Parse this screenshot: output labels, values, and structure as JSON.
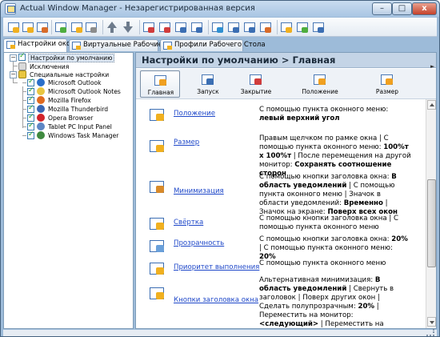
{
  "window": {
    "title": "Actual Window Manager - Незарегистрированная версия",
    "controls": {
      "minimize": "–",
      "maximize": "□",
      "close": "x"
    }
  },
  "toolbar": {
    "buttons": [
      "new-window-icon",
      "settings-icon",
      "refresh-icon",
      "add-rule-icon",
      "copy-icon",
      "paste-icon",
      "move-up-icon",
      "move-down-icon",
      "sort-az-icon",
      "sort-za-icon",
      "minimize-all-icon",
      "restore-all-icon",
      "swap-icon",
      "undo-icon",
      "redo-icon",
      "options-icon",
      "help-icon",
      "email-icon",
      "support-icon"
    ]
  },
  "tabs": [
    {
      "label": "Настройки окон",
      "active": true
    },
    {
      "label": "Виртуальные Рабочие Столы",
      "active": false
    },
    {
      "label": "Профили Рабочего Стола",
      "active": false
    }
  ],
  "tree": {
    "root": "Настройки по умолчанию",
    "exclusions": "Исключения",
    "specific": "Специальные настройки",
    "items": [
      {
        "label": "Microsoft Outlook",
        "icon": "outlook-icon",
        "color": "#2a6fc9"
      },
      {
        "label": "Microsoft Outlook Notes",
        "icon": "outlook-notes-icon",
        "color": "#e8c640"
      },
      {
        "label": "Mozilla Firefox",
        "icon": "firefox-icon",
        "color": "#e06b1f"
      },
      {
        "label": "Mozilla Thunderbird",
        "icon": "thunderbird-icon",
        "color": "#3a67b5"
      },
      {
        "label": "Opera Browser",
        "icon": "opera-icon",
        "color": "#d2232a"
      },
      {
        "label": "Tablet PC Input Panel",
        "icon": "tablet-pc-icon",
        "color": "#5d86c4"
      },
      {
        "label": "Windows Task Manager",
        "icon": "task-manager-icon",
        "color": "#3f8a3f"
      }
    ]
  },
  "main": {
    "title": "Настройки по умолчанию > Главная",
    "categories": [
      {
        "label": "Главная",
        "icon": "main-icon",
        "active": true
      },
      {
        "label": "Запуск",
        "icon": "startup-icon",
        "active": false
      },
      {
        "label": "Закрытие",
        "icon": "closing-icon",
        "active": false
      },
      {
        "label": "Положение",
        "icon": "position-icon",
        "active": false
      },
      {
        "label": "Размер",
        "icon": "size-icon",
        "active": false
      }
    ],
    "features": [
      {
        "label": "Положение",
        "icon": "position-feature-icon",
        "segments": [
          {
            "text": "С помощью пункта оконного меню: ",
            "bold": false
          },
          {
            "text": "левый верхний угол",
            "bold": true
          }
        ]
      },
      {
        "label": "Размер",
        "icon": "size-feature-icon",
        "segments": [
          {
            "text": "Правым щелчком по рамке окна | С помощью пункта оконного меню: ",
            "bold": false
          },
          {
            "text": "100%т x 100%т",
            "bold": true
          },
          {
            "text": " | После перемещения на другой монитор: ",
            "bold": false
          },
          {
            "text": "Сохранять соотношение сторон",
            "bold": true
          }
        ]
      },
      {
        "label": "Минимизация",
        "icon": "minimize-feature-icon",
        "segments": [
          {
            "text": "С помощью кнопки заголовка окна: ",
            "bold": false
          },
          {
            "text": "В область уведомлений",
            "bold": true
          },
          {
            "text": " | С помощью пункта оконного меню | Значок в области уведомлений: ",
            "bold": false
          },
          {
            "text": "Временно",
            "bold": true
          },
          {
            "text": " | Значок на экране: ",
            "bold": false
          },
          {
            "text": "Поверх всех окон",
            "bold": true
          }
        ]
      },
      {
        "label": "Свёртка",
        "icon": "rollup-feature-icon",
        "segments": [
          {
            "text": "С помощью кнопки заголовка окна | С помощью пункта оконного меню",
            "bold": false
          }
        ]
      },
      {
        "label": "Прозрачность",
        "icon": "transparency-feature-icon",
        "segments": [
          {
            "text": "С помощью кнопки заголовка окна: ",
            "bold": false
          },
          {
            "text": "20%",
            "bold": true
          },
          {
            "text": " | С помощью пункта оконного меню: ",
            "bold": false
          },
          {
            "text": "20%",
            "bold": true
          }
        ]
      },
      {
        "label": "Приоритет выполнения",
        "icon": "priority-feature-icon",
        "segments": [
          {
            "text": "С помощью пункта оконного меню",
            "bold": false
          }
        ]
      },
      {
        "label": "Кнопки заголовка окна",
        "icon": "title-buttons-feature-icon",
        "segments": [
          {
            "text": "Альтернативная минимизация: ",
            "bold": false
          },
          {
            "text": "В область уведомлений",
            "bold": true
          },
          {
            "text": " | Свернуть в заголовок | Поверх других окон | Сделать полупрозрачным: ",
            "bold": false
          },
          {
            "text": "20%",
            "bold": true
          },
          {
            "text": " | Переместить на монитор: ",
            "bold": false
          },
          {
            "text": "<следующий>",
            "bold": true
          },
          {
            "text": " | Переместить на виртуальный Рабочий Стол | Кнопка прочих действий",
            "bold": false
          }
        ]
      }
    ]
  }
}
